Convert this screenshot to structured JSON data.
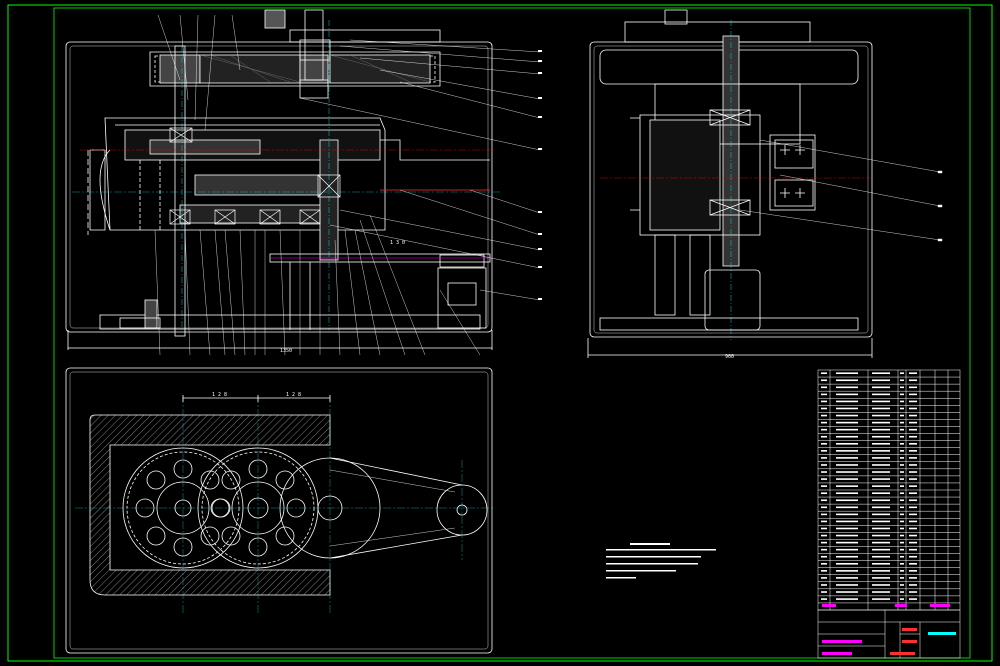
{
  "drawing": {
    "colors": {
      "background": "#000000",
      "frame": "#00ff00",
      "line": "#ffffff",
      "yellow": "#ffff00",
      "magenta": "#ff00ff",
      "cyan": "#00ffff",
      "red": "#ff3030",
      "green": "#00ff00"
    },
    "dimensions": {
      "front_bottom": "1350",
      "side_bottom": "900",
      "plan_a": "1 2 8",
      "plan_b": "1 2 8",
      "center": "1 3 0"
    }
  }
}
